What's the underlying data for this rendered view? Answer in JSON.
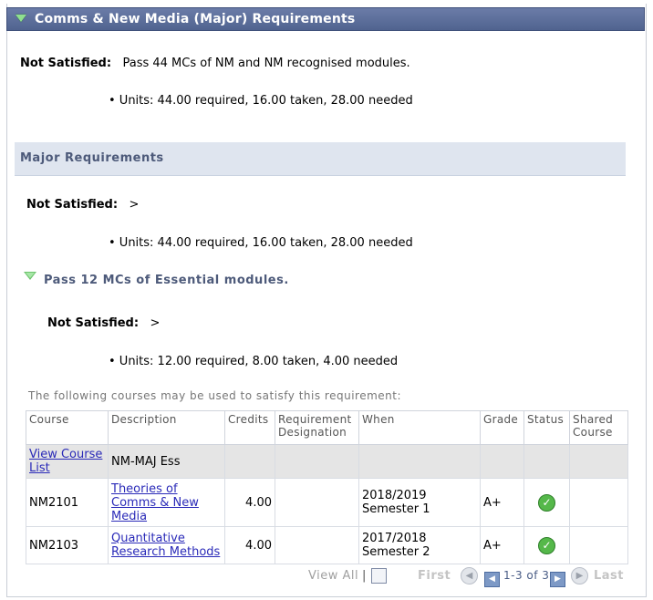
{
  "header": {
    "title": "Comms & New Media (Major) Requirements"
  },
  "top_status": {
    "label": "Not Satisfied:",
    "text": "Pass 44 MCs of NM and NM recognised modules."
  },
  "top_units": "• Units: 44.00 required, 16.00 taken, 28.00 needed",
  "major": {
    "title": "Major Requirements",
    "status_label": "Not Satisfied:",
    "status_text": ">",
    "units": "• Units: 44.00 required, 16.00 taken, 28.00 needed"
  },
  "essential": {
    "title": "Pass 12 MCs of Essential modules.",
    "status_label": "Not Satisfied:",
    "status_text": ">",
    "units": "• Units: 12.00 required, 8.00 taken, 4.00 needed",
    "note": "The following courses may be used to satisfy this requirement:"
  },
  "table": {
    "headers": [
      "Course",
      "Description",
      "Credits",
      "Requirement Designation",
      "When",
      "Grade",
      "Status",
      "Shared Course"
    ],
    "list_row": {
      "link": "View Course List",
      "description": "NM-MAJ Ess"
    },
    "rows": [
      {
        "course": "NM2101",
        "description": "Theories of Comms & New Media",
        "credits": "4.00",
        "designation": "",
        "when": "2018/2019 Semester 1",
        "grade": "A+",
        "status": "complete-check-icon"
      },
      {
        "course": "NM2103",
        "description": "Quantitative Research Methods",
        "credits": "4.00",
        "designation": "",
        "when": "2017/2018 Semester 2",
        "grade": "A+",
        "status": "complete-check-icon"
      }
    ]
  },
  "pager": {
    "view_all": "View All",
    "first": "First",
    "range": "1-3 of 3",
    "last": "Last"
  }
}
